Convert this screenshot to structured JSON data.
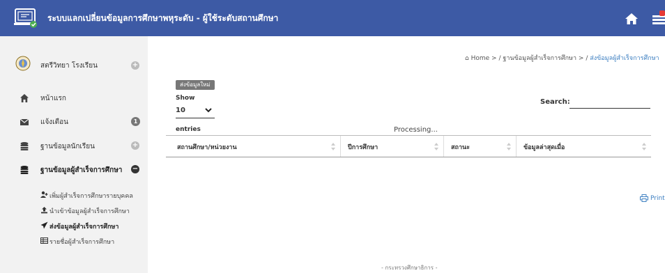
{
  "header": {
    "title": "ระบบแลกเปลี่ยนข้อมูลการศึกษาพหุระดับ - ผู้ใช้ระดับสถานศึกษา",
    "logo_icon": "laptop-check-icon",
    "home_icon": "home-icon",
    "notification_icon": "notification-icon"
  },
  "sidebar": {
    "school": {
      "label": "สตรีวิทยา โรงเรียน",
      "icon": "school-emblem-icon"
    },
    "items": [
      {
        "label": "หน้าแรก",
        "icon": "home-icon"
      },
      {
        "label": "แจ้งเตือน",
        "icon": "envelope-icon",
        "badge": "1"
      },
      {
        "label": "ฐานข้อมูลนักเรียน",
        "icon": "database-icon"
      },
      {
        "label": "ฐานข้อมูลผู้สำเร็จการศึกษา",
        "icon": "database-icon"
      }
    ],
    "subitems": [
      {
        "label": "เพิ่มผู้สำเร็จการศึกษารายบุคคล",
        "icon": "user-plus-icon"
      },
      {
        "label": "นำเข้าข้อมูลผู้สำเร็จการศึกษา",
        "icon": "upload-icon"
      },
      {
        "label": "ส่งข้อมูลผู้สำเร็จการศึกษา",
        "icon": "send-icon"
      },
      {
        "label": "รายชื่อผู้สำเร็จการศึกษา",
        "icon": "table-icon"
      }
    ]
  },
  "breadcrumb": {
    "home": "Home",
    "sep": ">",
    "level1": "ฐานข้อมูลผู้สำเร็จการศึกษา",
    "current": "ส่งข้อมูลผู้สำเร็จการศึกษา"
  },
  "main": {
    "send_new_label": "ส่งข้อมูลใหม่",
    "show_label": "Show",
    "page_length": "10",
    "entries_label": "entries",
    "search_label": "Search:",
    "search_value": "",
    "processing": "Processing...",
    "columns": [
      "สถานศึกษา/หน่วยงาน",
      "ปีการศึกษา",
      "สถานะ",
      "ข้อมูลล่าสุดเมื่อ"
    ],
    "print_label": "Print"
  },
  "footer": {
    "text": "- กระทรวงศึกษาธิการ -"
  },
  "colors": {
    "header": "#3d5aa5",
    "sidebar": "#f2f2f2",
    "link": "#3d7fc1"
  }
}
